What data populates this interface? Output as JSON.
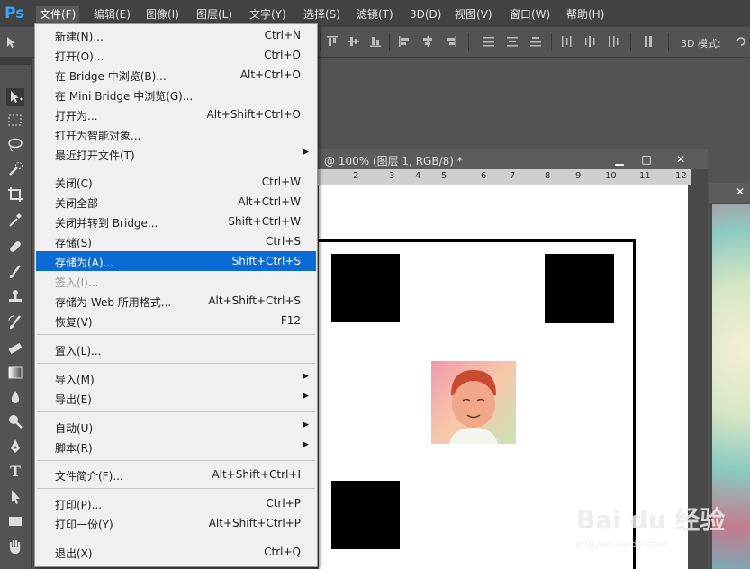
{
  "app": {
    "logo_text": "Ps"
  },
  "menubar": {
    "items": [
      {
        "label": "文件(F)"
      },
      {
        "label": "编辑(E)"
      },
      {
        "label": "图像(I)"
      },
      {
        "label": "图层(L)"
      },
      {
        "label": "文字(Y)"
      },
      {
        "label": "选择(S)"
      },
      {
        "label": "滤镜(T)"
      },
      {
        "label": "3D(D)"
      },
      {
        "label": "视图(V)"
      },
      {
        "label": "窗口(W)"
      },
      {
        "label": "帮助(H)"
      }
    ]
  },
  "options_bar": {
    "mode_label": "3D 模式:"
  },
  "document": {
    "title": "@ 100% (图层 1, RGB/8) *",
    "ruler_ticks": [
      "2",
      "3",
      "4",
      "5",
      "6",
      "7",
      "8",
      "9",
      "10",
      "11",
      "12"
    ],
    "buttons": {
      "minimize": "▁",
      "maximize": "□",
      "close": "✕"
    }
  },
  "file_menu": {
    "items": [
      {
        "label": "新建(N)...",
        "shortcut": "Ctrl+N"
      },
      {
        "label": "打开(O)...",
        "shortcut": "Ctrl+O"
      },
      {
        "label": "在 Bridge 中浏览(B)...",
        "shortcut": "Alt+Ctrl+O"
      },
      {
        "label": "在 Mini Bridge 中浏览(G)...",
        "shortcut": ""
      },
      {
        "label": "打开为...",
        "shortcut": "Alt+Shift+Ctrl+O"
      },
      {
        "label": "打开为智能对象...",
        "shortcut": ""
      },
      {
        "label": "最近打开文件(T)",
        "shortcut": "",
        "submenu": true
      },
      {
        "label": "关闭(C)",
        "shortcut": "Ctrl+W"
      },
      {
        "label": "关闭全部",
        "shortcut": "Alt+Ctrl+W"
      },
      {
        "label": "关闭并转到 Bridge...",
        "shortcut": "Shift+Ctrl+W"
      },
      {
        "label": "存储(S)",
        "shortcut": "Ctrl+S"
      },
      {
        "label": "存储为(A)...",
        "shortcut": "Shift+Ctrl+S",
        "highlighted": true
      },
      {
        "label": "签入(I)...",
        "shortcut": "",
        "disabled": true
      },
      {
        "label": "存储为 Web 所用格式...",
        "shortcut": "Alt+Shift+Ctrl+S"
      },
      {
        "label": "恢复(V)",
        "shortcut": "F12"
      },
      {
        "label": "置入(L)...",
        "shortcut": ""
      },
      {
        "label": "导入(M)",
        "shortcut": "",
        "submenu": true
      },
      {
        "label": "导出(E)",
        "shortcut": "",
        "submenu": true
      },
      {
        "label": "自动(U)",
        "shortcut": "",
        "submenu": true
      },
      {
        "label": "脚本(R)",
        "shortcut": "",
        "submenu": true
      },
      {
        "label": "文件简介(F)...",
        "shortcut": "Alt+Shift+Ctrl+I"
      },
      {
        "label": "打印(P)...",
        "shortcut": "Ctrl+P"
      },
      {
        "label": "打印一份(Y)",
        "shortcut": "Alt+Shift+Ctrl+P"
      },
      {
        "label": "退出(X)",
        "shortcut": "Ctrl+Q"
      }
    ],
    "submenu_arrow": "▶"
  },
  "watermark": {
    "brand": "Bai du 经验",
    "url": "jingyan.baidu.com"
  },
  "colors": {
    "highlight": "#0a6ad6",
    "ps_blue": "#31a8ff"
  }
}
